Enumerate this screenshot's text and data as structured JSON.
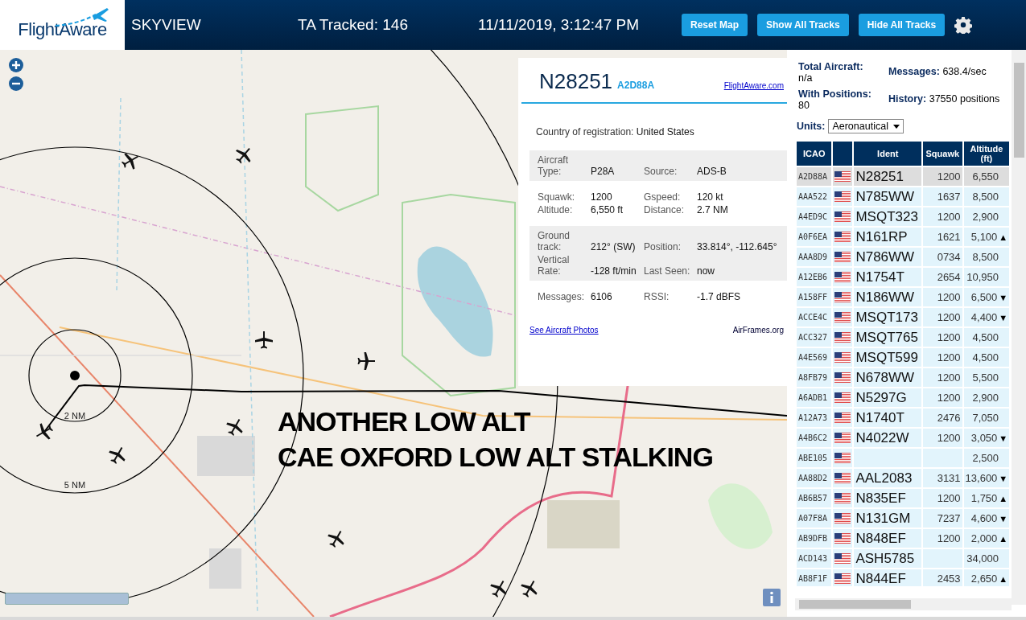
{
  "header": {
    "logo": "FlightAware",
    "title": "SKYVIEW",
    "tracked": "TA Tracked: 146",
    "datetime": "11/11/2019, 3:12:47 PM",
    "buttons": [
      "Reset Map",
      "Show All Tracks",
      "Hide All Tracks"
    ]
  },
  "map": {
    "range_labels": [
      "2 NM",
      "5 NM"
    ],
    "annotation": [
      "ANOTHER LOW ALT",
      "CAE OXFORD LOW ALT STALKING"
    ]
  },
  "info_panel": {
    "ident": "N28251",
    "icao": "A2D88A",
    "link": "FlightAware.com",
    "country_label": "Country of registration:",
    "country": "United States",
    "sections": [
      {
        "shaded": true,
        "fields": [
          {
            "label": "Aircraft Type:",
            "value": "P28A"
          },
          {
            "label": "Source:",
            "value": "ADS-B"
          }
        ]
      },
      {
        "shaded": false,
        "fields": [
          {
            "label": "Squawk:",
            "value": "1200"
          },
          {
            "label": "Gspeed:",
            "value": "120 kt"
          },
          {
            "label": "Altitude:",
            "value": "6,550 ft"
          },
          {
            "label": "Distance:",
            "value": "2.7 NM"
          }
        ]
      },
      {
        "shaded": true,
        "fields": [
          {
            "label": "Ground track:",
            "value": "212° (SW)"
          },
          {
            "label": "Position:",
            "value": "33.814°, -112.645°"
          },
          {
            "label": "Vertical Rate:",
            "value": "-128 ft/min"
          },
          {
            "label": "Last Seen:",
            "value": "now"
          }
        ]
      },
      {
        "shaded": false,
        "fields": [
          {
            "label": "Messages:",
            "value": "6106"
          },
          {
            "label": "RSSI:",
            "value": "-1.7 dBFS"
          }
        ]
      }
    ],
    "footer_links": [
      "See Aircraft Photos",
      "AirFrames.org"
    ]
  },
  "stats": [
    {
      "label": "Total Aircraft:",
      "value": "n/a"
    },
    {
      "label": "Messages:",
      "value": "638.4/sec"
    },
    {
      "label": "With Positions:",
      "value": "80"
    },
    {
      "label": "History:",
      "value": "37550 positions"
    }
  ],
  "units": {
    "label": "Units:",
    "value": "Aeronautical"
  },
  "table": {
    "columns": [
      "ICAO",
      "",
      "Ident",
      "Squawk",
      "Altitude (ft)"
    ],
    "rows": [
      {
        "icao": "A2D88A",
        "ident": "N28251",
        "squawk": "1200",
        "altitude": "6,550",
        "selected": true
      },
      {
        "icao": "AAA522",
        "ident": "N785WW",
        "squawk": "1637",
        "altitude": "8,500",
        "selected": false
      },
      {
        "icao": "A4ED9C",
        "ident": "MSQT323",
        "squawk": "1200",
        "altitude": "2,900",
        "selected": false
      },
      {
        "icao": "A0F6EA",
        "ident": "N161RP",
        "squawk": "1621",
        "altitude": "5,100",
        "trend": "▲",
        "selected": false
      },
      {
        "icao": "AAA8D9",
        "ident": "N786WW",
        "squawk": "0734",
        "altitude": "8,500",
        "selected": false
      },
      {
        "icao": "A12EB6",
        "ident": "N1754T",
        "squawk": "2654",
        "altitude": "10,950",
        "selected": false
      },
      {
        "icao": "A158FF",
        "ident": "N186WW",
        "squawk": "1200",
        "altitude": "6,500",
        "trend": "▼",
        "selected": false
      },
      {
        "icao": "ACCE4C",
        "ident": "MSQT173",
        "squawk": "1200",
        "altitude": "4,400",
        "trend": "▼",
        "selected": false
      },
      {
        "icao": "ACC327",
        "ident": "MSQT765",
        "squawk": "1200",
        "altitude": "4,500",
        "selected": false
      },
      {
        "icao": "A4E569",
        "ident": "MSQT599",
        "squawk": "1200",
        "altitude": "4,500",
        "selected": false
      },
      {
        "icao": "A8FB79",
        "ident": "N678WW",
        "squawk": "1200",
        "altitude": "5,500",
        "selected": false
      },
      {
        "icao": "A6ADB1",
        "ident": "N5297G",
        "squawk": "1200",
        "altitude": "2,900",
        "selected": false
      },
      {
        "icao": "A12A73",
        "ident": "N1740T",
        "squawk": "2476",
        "altitude": "7,050",
        "selected": false
      },
      {
        "icao": "A4B6C2",
        "ident": "N4022W",
        "squawk": "1200",
        "altitude": "3,050",
        "trend": "▼",
        "selected": false
      },
      {
        "icao": "ABE105",
        "altitude": "2,500",
        "selected": false
      },
      {
        "icao": "AA88D2",
        "ident": "AAL2083",
        "squawk": "3131",
        "altitude": "13,600",
        "trend": "▼",
        "selected": false
      },
      {
        "icao": "AB6B57",
        "ident": "N835EF",
        "squawk": "1200",
        "altitude": "1,750",
        "trend": "▲",
        "selected": false
      },
      {
        "icao": "A07F8A",
        "ident": "N131GM",
        "squawk": "7237",
        "altitude": "4,600",
        "trend": "▼",
        "selected": false
      },
      {
        "icao": "AB9DFB",
        "ident": "N848EF",
        "squawk": "1200",
        "altitude": "2,000",
        "trend": "▲",
        "selected": false
      },
      {
        "icao": "ACD143",
        "ident": "ASH5785",
        "altitude": "34,000",
        "selected": false
      },
      {
        "icao": "AB8F1F",
        "ident": "N844EF",
        "squawk": "2453",
        "altitude": "2,650",
        "trend": "▲",
        "selected": false
      }
    ]
  }
}
